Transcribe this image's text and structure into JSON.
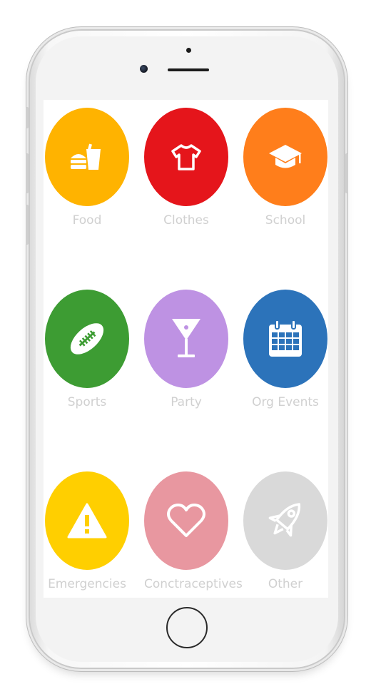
{
  "categories": [
    {
      "label": "Food",
      "color": "#FFB300",
      "icon": "fastfood-icon"
    },
    {
      "label": "Clothes",
      "color": "#E5151B",
      "icon": "tshirt-icon"
    },
    {
      "label": "School",
      "color": "#FF7E1B",
      "icon": "graduation-cap-icon"
    },
    {
      "label": "Sports",
      "color": "#3D9C33",
      "icon": "football-icon"
    },
    {
      "label": "Party",
      "color": "#BE92E3",
      "icon": "cocktail-glass-icon"
    },
    {
      "label": "Org Events",
      "color": "#2C73BA",
      "icon": "calendar-icon"
    },
    {
      "label": "Emergencies",
      "color": "#FFCF00",
      "icon": "warning-icon"
    },
    {
      "label": "Conctraceptives",
      "color": "#E897A0",
      "icon": "heart-icon"
    },
    {
      "label": "Other",
      "color": "#D9D9D9",
      "icon": "rocket-icon"
    }
  ]
}
